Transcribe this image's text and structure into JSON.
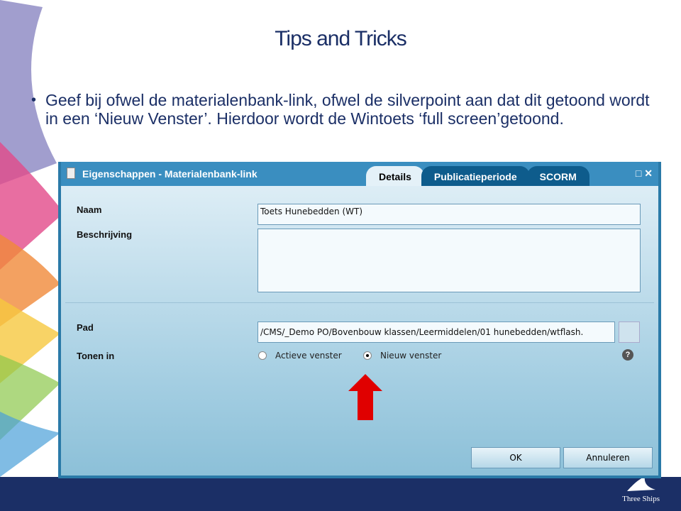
{
  "slide": {
    "title": "Tips and Tricks",
    "bullet": "Geef bij ofwel de materialenbank-link, ofwel de silverpoint aan dat dit getoond wordt in een ‘Nieuw Venster’. Hierdoor wordt de Wintoets ‘full screen’getoond.",
    "logo": "Three Ships"
  },
  "dialog": {
    "title": "Eigenschappen - Materialenbank-link",
    "tabs": [
      "Details",
      "Publicatieperiode",
      "SCORM"
    ],
    "naam_label": "Naam",
    "naam_value": "Toets Hunebedden (WT)",
    "beschrijving_label": "Beschrijving",
    "beschrijving_value": "",
    "pad_label": "Pad",
    "pad_value": "/CMS/_Demo PO/Bovenbouw klassen/Leermiddelen/01 hunebedden/wtflash.",
    "tonen_label": "Tonen in",
    "options": [
      "Actieve venster",
      "Nieuw venster"
    ],
    "selected": "Nieuw venster",
    "ok": "OK",
    "cancel": "Annuleren"
  },
  "colors": {
    "title": "#1b2f66",
    "arrow": "#e00000",
    "titlebar": "#3a8ec0"
  }
}
